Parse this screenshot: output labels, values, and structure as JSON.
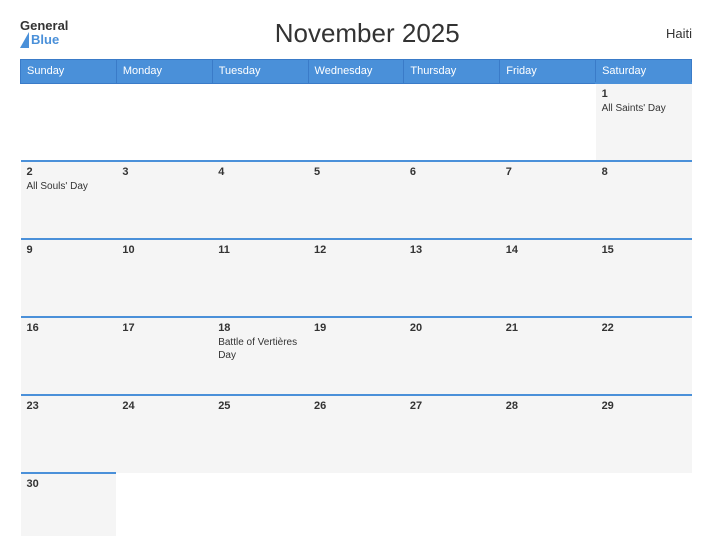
{
  "logo": {
    "general": "General",
    "blue": "Blue"
  },
  "title": "November 2025",
  "country": "Haiti",
  "days_of_week": [
    "Sunday",
    "Monday",
    "Tuesday",
    "Wednesday",
    "Thursday",
    "Friday",
    "Saturday"
  ],
  "weeks": [
    [
      {
        "day": "",
        "event": "",
        "empty": true
      },
      {
        "day": "",
        "event": "",
        "empty": true
      },
      {
        "day": "",
        "event": "",
        "empty": true
      },
      {
        "day": "",
        "event": "",
        "empty": true
      },
      {
        "day": "",
        "event": "",
        "empty": true
      },
      {
        "day": "",
        "event": "",
        "empty": true
      },
      {
        "day": "1",
        "event": "All Saints' Day",
        "empty": false
      }
    ],
    [
      {
        "day": "2",
        "event": "All Souls' Day",
        "empty": false
      },
      {
        "day": "3",
        "event": "",
        "empty": false
      },
      {
        "day": "4",
        "event": "",
        "empty": false
      },
      {
        "day": "5",
        "event": "",
        "empty": false
      },
      {
        "day": "6",
        "event": "",
        "empty": false
      },
      {
        "day": "7",
        "event": "",
        "empty": false
      },
      {
        "day": "8",
        "event": "",
        "empty": false
      }
    ],
    [
      {
        "day": "9",
        "event": "",
        "empty": false
      },
      {
        "day": "10",
        "event": "",
        "empty": false
      },
      {
        "day": "11",
        "event": "",
        "empty": false
      },
      {
        "day": "12",
        "event": "",
        "empty": false
      },
      {
        "day": "13",
        "event": "",
        "empty": false
      },
      {
        "day": "14",
        "event": "",
        "empty": false
      },
      {
        "day": "15",
        "event": "",
        "empty": false
      }
    ],
    [
      {
        "day": "16",
        "event": "",
        "empty": false
      },
      {
        "day": "17",
        "event": "",
        "empty": false
      },
      {
        "day": "18",
        "event": "Battle of Vertières Day",
        "empty": false
      },
      {
        "day": "19",
        "event": "",
        "empty": false
      },
      {
        "day": "20",
        "event": "",
        "empty": false
      },
      {
        "day": "21",
        "event": "",
        "empty": false
      },
      {
        "day": "22",
        "event": "",
        "empty": false
      }
    ],
    [
      {
        "day": "23",
        "event": "",
        "empty": false
      },
      {
        "day": "24",
        "event": "",
        "empty": false
      },
      {
        "day": "25",
        "event": "",
        "empty": false
      },
      {
        "day": "26",
        "event": "",
        "empty": false
      },
      {
        "day": "27",
        "event": "",
        "empty": false
      },
      {
        "day": "28",
        "event": "",
        "empty": false
      },
      {
        "day": "29",
        "event": "",
        "empty": false
      }
    ],
    [
      {
        "day": "30",
        "event": "",
        "empty": false
      },
      {
        "day": "",
        "event": "",
        "empty": true
      },
      {
        "day": "",
        "event": "",
        "empty": true
      },
      {
        "day": "",
        "event": "",
        "empty": true
      },
      {
        "day": "",
        "event": "",
        "empty": true
      },
      {
        "day": "",
        "event": "",
        "empty": true
      },
      {
        "day": "",
        "event": "",
        "empty": true
      }
    ]
  ]
}
